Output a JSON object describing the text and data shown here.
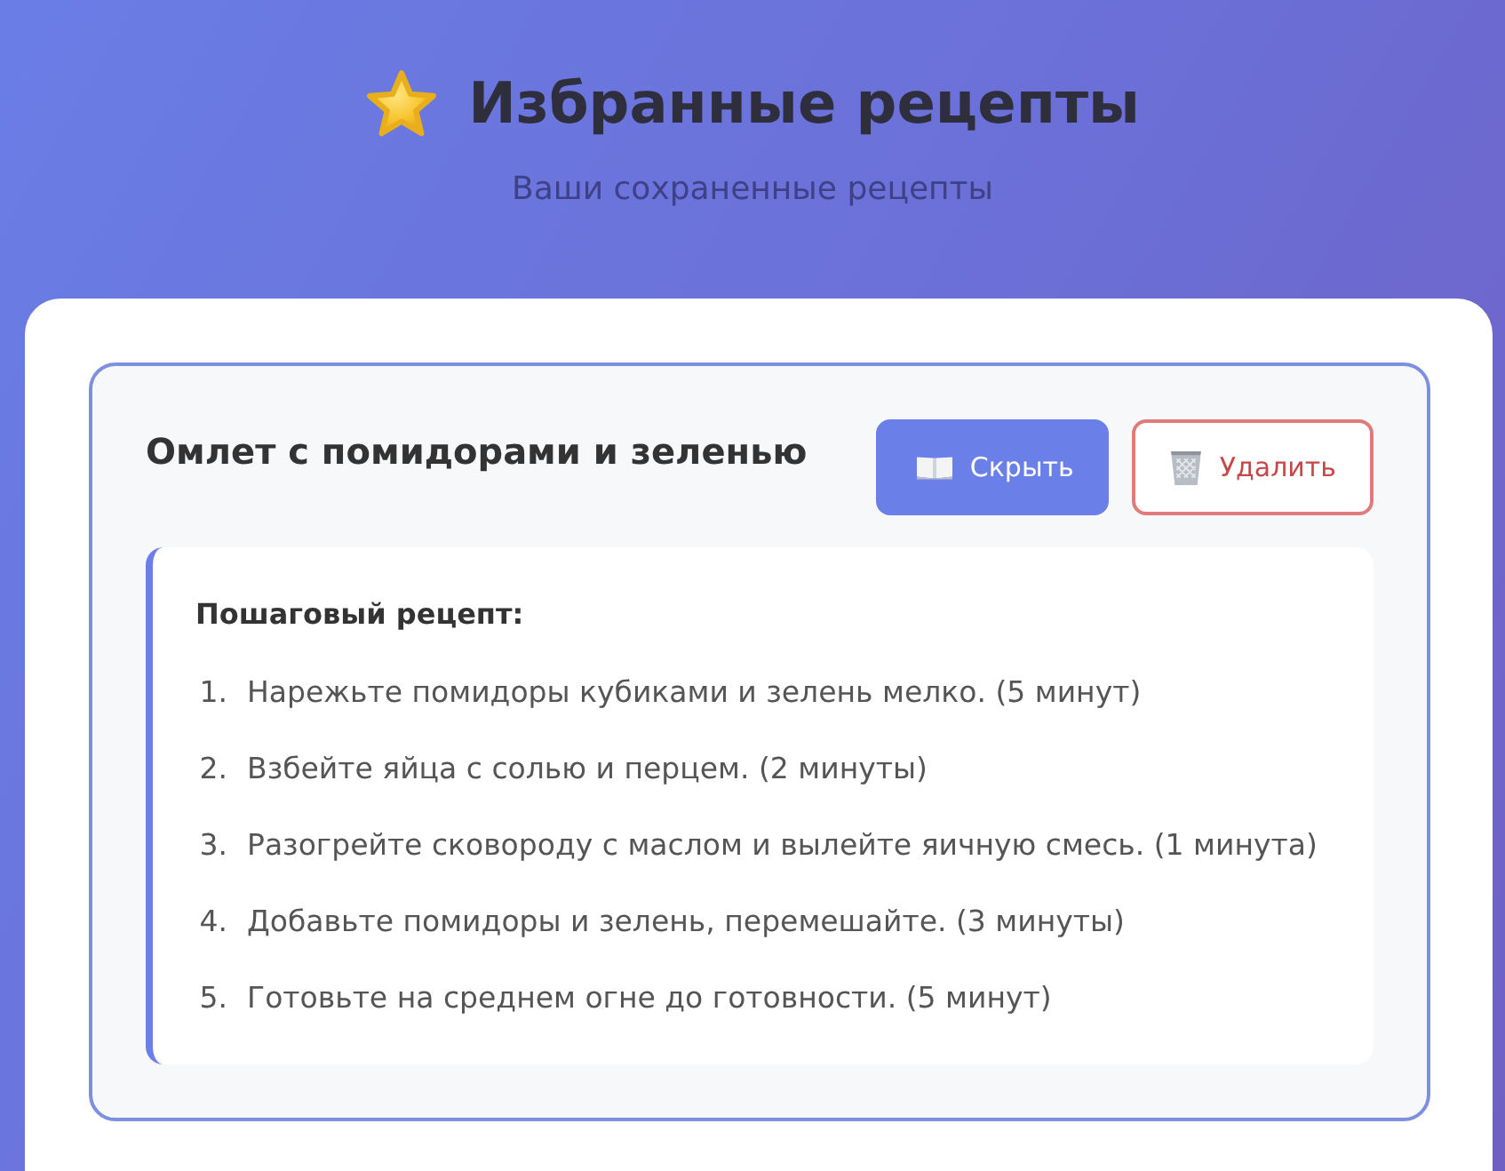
{
  "header": {
    "title": "Избранные рецепты",
    "subtitle": "Ваши сохраненные рецепты"
  },
  "recipes": [
    {
      "title": "Омлет с помидорами и зеленью",
      "expanded": true,
      "buttons": [
        {
          "kind": "toggle",
          "label": "Скрыть"
        },
        {
          "kind": "delete",
          "label": "Удалить"
        }
      ],
      "steps_heading": "Пошаговый рецепт:",
      "steps": [
        {
          "number": "1.",
          "text": "Нарежьте помидоры кубиками и зелень мелко. (5 минут)"
        },
        {
          "number": "2.",
          "text": "Взбейте яйца с солью и перцем. (2 минуты)"
        },
        {
          "number": "3.",
          "text": "Разогрейте сковороду с маслом и вылейте яичную смесь. (1 минута)"
        },
        {
          "number": "4.",
          "text": "Добавьте помидоры и зелень, перемешайте. (3 минуты)"
        },
        {
          "number": "5.",
          "text": "Готовьте на среднем огне до готовности. (5 минут)"
        }
      ]
    }
  ]
}
